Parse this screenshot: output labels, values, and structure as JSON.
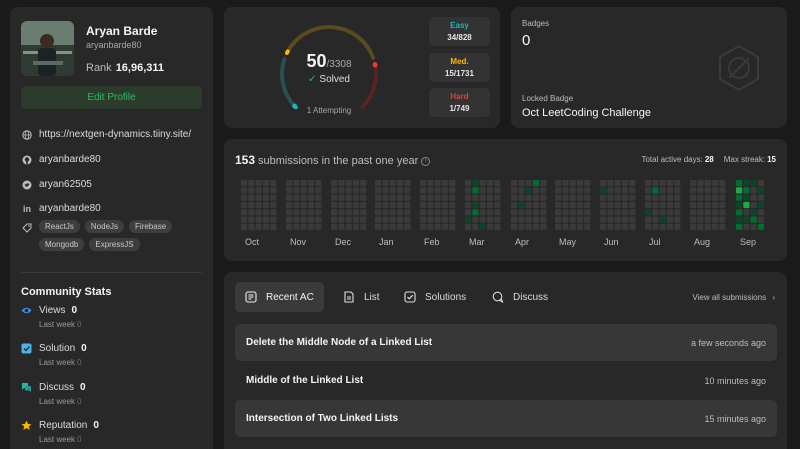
{
  "profile": {
    "name": "Aryan Barde",
    "username": "aryanbarde80",
    "rank_label": "Rank",
    "rank_value": "16,96,311",
    "edit_label": "Edit Profile",
    "website": "https://nextgen-dynamics.tiiny.site/",
    "github": "aryanbarde80",
    "twitter": "aryan62505",
    "linkedin": "aryanbarde80",
    "skills": [
      "ReactJs",
      "NodeJs",
      "Firebase",
      "Mongodb",
      "ExpressJS"
    ]
  },
  "community": {
    "title": "Community Stats",
    "last_week_label": "Last week",
    "items": [
      {
        "label": "Views",
        "value": "0",
        "last_week": "0",
        "icon": "eye-icon",
        "color": "#3d8eea"
      },
      {
        "label": "Solution",
        "value": "0",
        "last_week": "0",
        "icon": "solution-icon",
        "color": "#49b4ec"
      },
      {
        "label": "Discuss",
        "value": "0",
        "last_week": "0",
        "icon": "discuss-icon",
        "color": "#2db6a3"
      },
      {
        "label": "Reputation",
        "value": "0",
        "last_week": "0",
        "icon": "star-icon",
        "color": "#ffb800"
      }
    ]
  },
  "solved": {
    "count": "50",
    "total": "/3308",
    "label": "Solved",
    "attempting": "1 Attempting",
    "easy": {
      "label": "Easy",
      "value": "34/828",
      "solved": 34,
      "total": 828,
      "color": "#1cbaba"
    },
    "medium": {
      "label": "Med.",
      "value": "15/1731",
      "solved": 15,
      "total": 1731,
      "color": "#ffb700"
    },
    "hard": {
      "label": "Hard",
      "value": "1/749",
      "solved": 1,
      "total": 749,
      "color": "#f63737"
    }
  },
  "badges": {
    "label": "Badges",
    "count": "0",
    "locked_label": "Locked Badge",
    "locked_name": "Oct LeetCoding Challenge"
  },
  "heatmap": {
    "count": "153",
    "title_text": "submissions in the past one year",
    "active_days_label": "Total active days:",
    "active_days": "28",
    "max_streak_label": "Max streak:",
    "max_streak": "15",
    "months": [
      "Oct",
      "Nov",
      "Dec",
      "Jan",
      "Feb",
      "Mar",
      "Apr",
      "May",
      "Jun",
      "Jul",
      "Aug",
      "Sep"
    ],
    "active_cells": [
      {
        "month": 5,
        "col": 0,
        "row": 5,
        "level": 1
      },
      {
        "month": 5,
        "col": 1,
        "row": 0,
        "level": 1
      },
      {
        "month": 5,
        "col": 1,
        "row": 1,
        "level": 2
      },
      {
        "month": 5,
        "col": 1,
        "row": 3,
        "level": 1
      },
      {
        "month": 5,
        "col": 1,
        "row": 4,
        "level": 2
      },
      {
        "month": 5,
        "col": 2,
        "row": 6,
        "level": 1
      },
      {
        "month": 6,
        "col": 1,
        "row": 3,
        "level": 1
      },
      {
        "month": 6,
        "col": 2,
        "row": 1,
        "level": 1
      },
      {
        "month": 6,
        "col": 3,
        "row": 0,
        "level": 2
      },
      {
        "month": 8,
        "col": 0,
        "row": 1,
        "level": 1
      },
      {
        "month": 9,
        "col": 0,
        "row": 4,
        "level": 1
      },
      {
        "month": 9,
        "col": 1,
        "row": 1,
        "level": 2
      },
      {
        "month": 9,
        "col": 2,
        "row": 5,
        "level": 1
      },
      {
        "month": 11,
        "col": 0,
        "row": 0,
        "level": 2
      },
      {
        "month": 11,
        "col": 0,
        "row": 1,
        "level": 3
      },
      {
        "month": 11,
        "col": 0,
        "row": 2,
        "level": 2
      },
      {
        "month": 11,
        "col": 0,
        "row": 3,
        "level": 1
      },
      {
        "month": 11,
        "col": 0,
        "row": 4,
        "level": 2
      },
      {
        "month": 11,
        "col": 0,
        "row": 5,
        "level": 1
      },
      {
        "month": 11,
        "col": 0,
        "row": 6,
        "level": 2
      },
      {
        "month": 11,
        "col": 1,
        "row": 0,
        "level": 1
      },
      {
        "month": 11,
        "col": 1,
        "row": 1,
        "level": 2
      },
      {
        "month": 11,
        "col": 1,
        "row": 2,
        "level": 1
      },
      {
        "month": 11,
        "col": 1,
        "row": 3,
        "level": 3
      },
      {
        "month": 11,
        "col": 1,
        "row": 5,
        "level": 1
      },
      {
        "month": 11,
        "col": 2,
        "row": 0,
        "level": 1
      },
      {
        "month": 11,
        "col": 2,
        "row": 4,
        "level": 1
      },
      {
        "month": 11,
        "col": 2,
        "row": 5,
        "level": 2
      },
      {
        "month": 11,
        "col": 3,
        "row": 1,
        "level": 1
      },
      {
        "month": 11,
        "col": 3,
        "row": 3,
        "level": 1
      },
      {
        "month": 11,
        "col": 3,
        "row": 6,
        "level": 2
      }
    ]
  },
  "recent": {
    "tabs": [
      {
        "label": "Recent AC",
        "icon": "recent-ac-icon"
      },
      {
        "label": "List",
        "icon": "list-icon"
      },
      {
        "label": "Solutions",
        "icon": "solutions-icon"
      },
      {
        "label": "Discuss",
        "icon": "discuss-icon"
      }
    ],
    "view_all": "View all submissions",
    "submissions": [
      {
        "title": "Delete the Middle Node of a Linked List",
        "time": "a few seconds ago"
      },
      {
        "title": "Middle of the Linked List",
        "time": "10 minutes ago"
      },
      {
        "title": "Intersection of Two Linked Lists",
        "time": "15 minutes ago"
      }
    ]
  }
}
